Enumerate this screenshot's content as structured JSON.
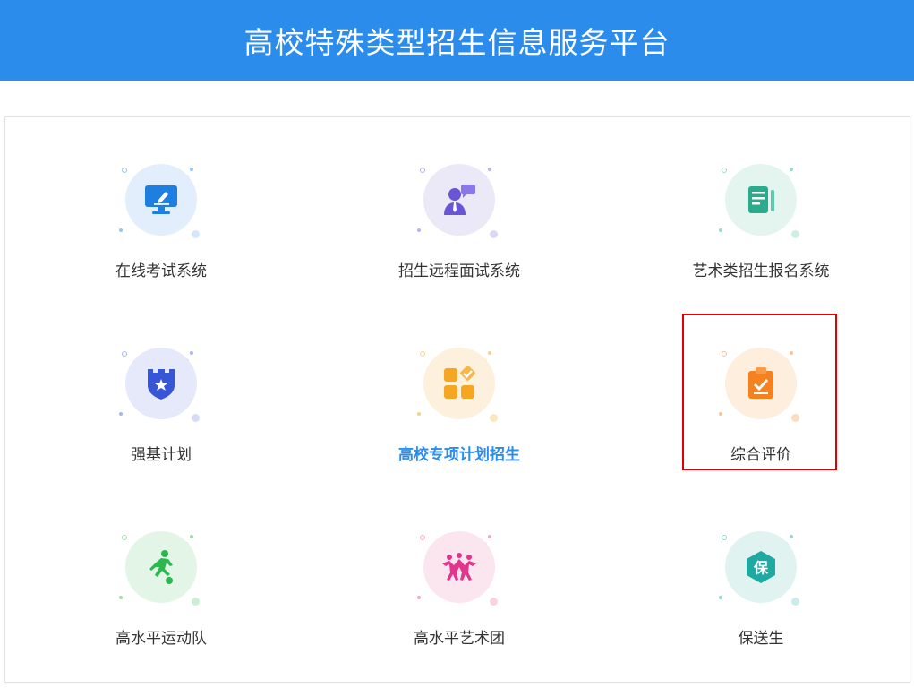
{
  "header": {
    "title": "高校特殊类型招生信息服务平台"
  },
  "items": [
    {
      "label": "在线考试系统",
      "icon": "monitor-pen-icon",
      "color": "#1e7fe0",
      "bg": "#e3eefc"
    },
    {
      "label": "招生远程面试系统",
      "icon": "interviewer-icon",
      "color": "#6a55d6",
      "bg": "#ebe8f8"
    },
    {
      "label": "艺术类招生报名系统",
      "icon": "document-list-icon",
      "color": "#2bab8e",
      "bg": "#e4f5f0"
    },
    {
      "label": "强基计划",
      "icon": "castle-shield-icon",
      "color": "#3656d6",
      "bg": "#e6e9f9"
    },
    {
      "label": "高校专项计划招生",
      "icon": "apps-grid-icon",
      "color": "#f5a623",
      "bg": "#fdf1dd"
    },
    {
      "label": "综合评价",
      "icon": "clipboard-check-icon",
      "color": "#f5821f",
      "bg": "#fdeedd"
    },
    {
      "label": "高水平运动队",
      "icon": "soccer-player-icon",
      "color": "#2bb84f",
      "bg": "#e2f5e6"
    },
    {
      "label": "高水平艺术团",
      "icon": "dancers-icon",
      "color": "#e0368c",
      "bg": "#fbe5ef"
    },
    {
      "label": "保送生",
      "icon": "hexagon-bao-icon",
      "color": "#1fa9a3",
      "bg": "#e1f3f1",
      "glyph": "保"
    }
  ],
  "active_item": "高校专项计划招生"
}
